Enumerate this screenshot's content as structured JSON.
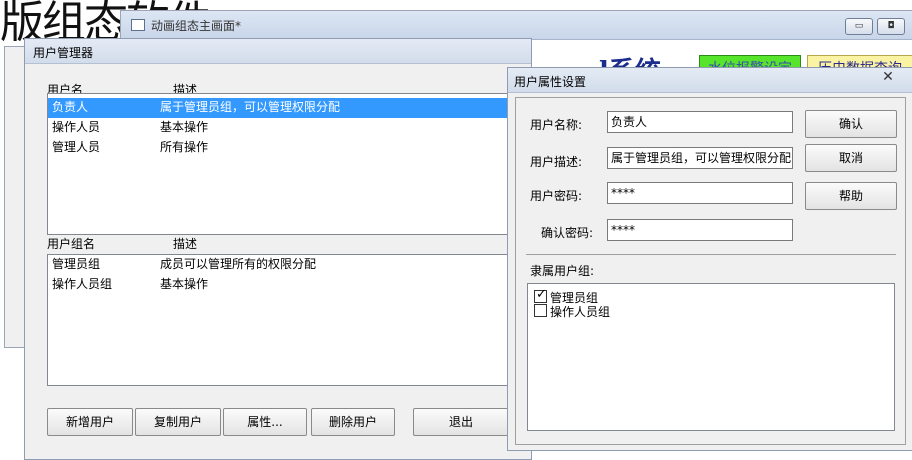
{
  "background": {
    "large_text": "版组态软件",
    "main_window_title": "动画组态主画面*",
    "system_title": "l系统",
    "alarm_button": "水位报警设定",
    "history_button": "历史数据查询"
  },
  "user_manager": {
    "title": "用户管理器",
    "user_list": {
      "headers": {
        "name": "用户名",
        "desc": "描述"
      },
      "rows": [
        {
          "name": "负责人",
          "desc": "属于管理员组，可以管理权限分配",
          "selected": true
        },
        {
          "name": "操作人员",
          "desc": "基本操作",
          "selected": false
        },
        {
          "name": "管理人员",
          "desc": "所有操作",
          "selected": false
        }
      ]
    },
    "group_list": {
      "headers": {
        "name": "用户组名",
        "desc": "描述"
      },
      "rows": [
        {
          "name": "管理员组",
          "desc": "成员可以管理所有的权限分配"
        },
        {
          "name": "操作人员组",
          "desc": "基本操作"
        }
      ]
    },
    "buttons": {
      "add": "新增用户",
      "copy": "复制用户",
      "props": "属性...",
      "delete": "删除用户",
      "exit": "退出"
    }
  },
  "user_props": {
    "title": "用户属性设置",
    "close_symbol": "✕",
    "labels": {
      "name": "用户名称:",
      "desc": "用户描述:",
      "password": "用户密码:",
      "confirm": "确认密码:",
      "groups": "隶属用户组:"
    },
    "values": {
      "name": "负责人",
      "desc": "属于管理员组，可以管理权限分配",
      "password": "****",
      "confirm": "****"
    },
    "buttons": {
      "ok": "确认",
      "cancel": "取消",
      "help": "帮助"
    },
    "groups": [
      {
        "name": "管理员组",
        "checked": true
      },
      {
        "name": "操作人员组",
        "checked": false
      }
    ]
  }
}
